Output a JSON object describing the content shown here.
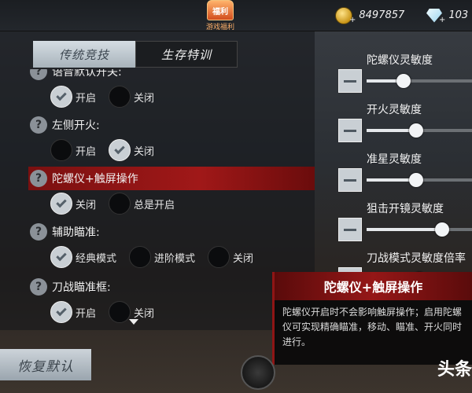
{
  "topbar": {
    "bonus": {
      "badge": "福利",
      "sub": "游戏福利"
    },
    "coins": {
      "amount": "8497857",
      "icon": "coin-icon"
    },
    "diamonds": {
      "amount": "103",
      "icon": "diamond-icon"
    },
    "plus_glyph": "+"
  },
  "tabs": [
    {
      "label": "传统竞技",
      "active": true
    },
    {
      "label": "生存特训",
      "active": false
    }
  ],
  "settings": [
    {
      "title": "语音默认开关:",
      "options": [
        {
          "label": "开启",
          "checked": true
        },
        {
          "label": "关闭",
          "checked": false
        }
      ]
    },
    {
      "title": "左侧开火:",
      "options": [
        {
          "label": "开启",
          "checked": false
        },
        {
          "label": "关闭",
          "checked": true
        }
      ]
    },
    {
      "title": "陀螺仪+触屏操作",
      "highlight": true,
      "options": [
        {
          "label": "关闭",
          "checked": true
        },
        {
          "label": "总是开启",
          "checked": false
        }
      ]
    },
    {
      "title": "辅助瞄准:",
      "options": [
        {
          "label": "经典模式",
          "checked": true
        },
        {
          "label": "进阶模式",
          "checked": false
        },
        {
          "label": "关闭",
          "checked": false
        }
      ]
    },
    {
      "title": "刀战瞄准框:",
      "options": [
        {
          "label": "开启",
          "checked": true
        },
        {
          "label": "关闭",
          "checked": false
        }
      ]
    }
  ],
  "help_glyph": "?",
  "restore_button": "恢复默认",
  "sliders": [
    {
      "label": "陀螺仪灵敏度",
      "value": 0.35
    },
    {
      "label": "开火灵敏度",
      "value": 0.47
    },
    {
      "label": "准星灵敏度",
      "value": 0.47
    },
    {
      "label": "狙击开镜灵敏度",
      "value": 0.72
    },
    {
      "label": "刀战模式灵敏度倍率",
      "value": 0.5
    }
  ],
  "tooltip": {
    "title": "陀螺仪+触屏操作",
    "body": "陀螺仪开启时不会影响触屏操作；启用陀螺仪可实现精确瞄准，移动、瞄准、开火同时进行。"
  },
  "watermark": "头条",
  "colors": {
    "highlight": "#a01818",
    "active_tab": "#c9d1d7"
  }
}
